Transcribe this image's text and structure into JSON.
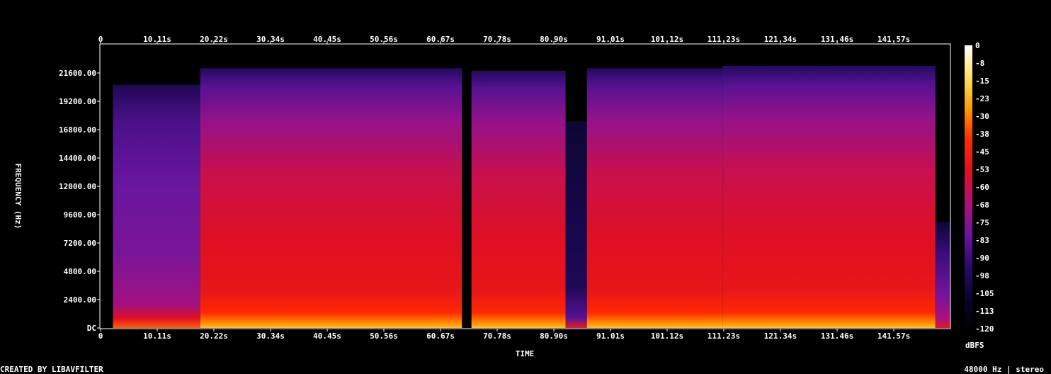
{
  "chart_data": {
    "type": "heatmap",
    "title": "",
    "xlabel": "TIME",
    "ylabel": "FREQUENCY (Hz)",
    "x_ticks": [
      "0",
      "10.11s",
      "20.22s",
      "30.34s",
      "40.45s",
      "50.56s",
      "60.67s",
      "70.78s",
      "80.90s",
      "91.01s",
      "101.12s",
      "111.23s",
      "121.34s",
      "131.46s",
      "141.57s"
    ],
    "x_tick_values_s": [
      0,
      10.11,
      20.22,
      30.34,
      40.45,
      50.56,
      60.67,
      70.78,
      80.9,
      91.01,
      101.12,
      111.23,
      121.34,
      131.46,
      141.57
    ],
    "x_range_s": [
      0,
      151.68
    ],
    "y_ticks": [
      "DC",
      "2400.00",
      "4800.00",
      "7200.00",
      "9600.00",
      "12000.00",
      "14400.00",
      "16800.00",
      "19200.00",
      "21600.00"
    ],
    "y_tick_values_hz": [
      0,
      2400,
      4800,
      7200,
      9600,
      12000,
      14400,
      16800,
      19200,
      21600
    ],
    "y_range_hz": [
      0,
      24000
    ],
    "colorbar": {
      "label": "dBFS",
      "ticks": [
        "0",
        "-8",
        "-15",
        "-23",
        "-30",
        "-38",
        "-45",
        "-53",
        "-60",
        "-68",
        "-75",
        "-83",
        "-90",
        "-98",
        "-105",
        "-113",
        "-120"
      ],
      "range_db": [
        -120,
        0
      ],
      "colors": [
        "#000000",
        "#0a0530",
        "#2a0a6e",
        "#6a16a0",
        "#b0107a",
        "#e01020",
        "#ff2a00",
        "#ff9a00",
        "#ffe060",
        "#ffffff"
      ]
    },
    "segments": [
      {
        "start_s": 0,
        "end_s": 2.2,
        "level": "silent",
        "max_freq_hz": 0
      },
      {
        "start_s": 2.2,
        "end_s": 17.8,
        "level": "low",
        "max_freq_hz": 20600
      },
      {
        "start_s": 17.8,
        "end_s": 64.5,
        "level": "high",
        "max_freq_hz": 22000
      },
      {
        "start_s": 64.5,
        "end_s": 66.2,
        "level": "silent",
        "max_freq_hz": 2000
      },
      {
        "start_s": 66.2,
        "end_s": 83.0,
        "level": "high",
        "max_freq_hz": 21800
      },
      {
        "start_s": 83.0,
        "end_s": 86.8,
        "level": "quiet",
        "max_freq_hz": 17500
      },
      {
        "start_s": 86.8,
        "end_s": 111.0,
        "level": "high",
        "max_freq_hz": 22000
      },
      {
        "start_s": 111.0,
        "end_s": 149.0,
        "level": "high",
        "max_freq_hz": 22200
      },
      {
        "start_s": 149.0,
        "end_s": 151.68,
        "level": "fade",
        "max_freq_hz": 9000
      }
    ],
    "grid": false
  },
  "footer": {
    "left": "CREATED BY LIBAVFILTER",
    "right": "48000 Hz | stereo"
  }
}
